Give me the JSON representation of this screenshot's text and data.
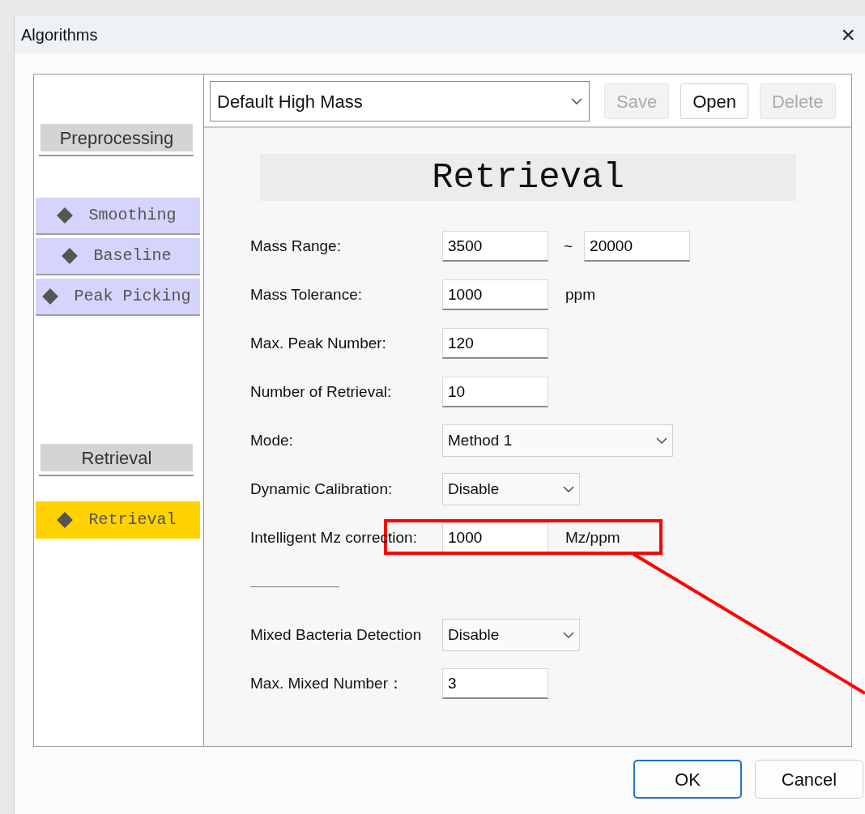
{
  "window": {
    "title": "Algorithms",
    "close": "×"
  },
  "sidebar": {
    "sections": [
      {
        "title": "Preprocessing",
        "items": [
          {
            "label": "Smoothing",
            "selected": false
          },
          {
            "label": "Baseline",
            "selected": false
          },
          {
            "label": "Peak Picking",
            "selected": false
          }
        ]
      },
      {
        "title": "Retrieval",
        "items": [
          {
            "label": "Retrieval",
            "selected": true
          }
        ]
      }
    ]
  },
  "toolbar": {
    "preset": "Default High Mass",
    "buttons": [
      {
        "label": "Save",
        "disabled": true
      },
      {
        "label": "Open",
        "disabled": false
      },
      {
        "label": "Delete",
        "disabled": true
      }
    ]
  },
  "heading": "Retrieval",
  "form": {
    "rows": [
      {
        "kind": "range",
        "label": "Mass Range:",
        "value": "3500",
        "separator": "~",
        "value2": "20000"
      },
      {
        "kind": "input",
        "label": "Mass Tolerance:",
        "value": "1000",
        "unit": "ppm"
      },
      {
        "kind": "input",
        "label": "Max. Peak Number:",
        "value": "120"
      },
      {
        "kind": "input",
        "label": "Number of Retrieval:",
        "value": "10"
      },
      {
        "kind": "combo",
        "label": "Mode:",
        "value": "Method 1"
      },
      {
        "kind": "select",
        "label": "Dynamic Calibration:",
        "value": "Disable"
      },
      {
        "kind": "input",
        "label": "Intelligent Mz correction:",
        "value": "1000",
        "unit": "Mz/ppm"
      },
      {
        "kind": "divider"
      },
      {
        "kind": "select",
        "label": "Mixed Bacteria Detection",
        "value": "Disable"
      },
      {
        "kind": "input",
        "label": "Max. Mixed Number：",
        "value": "3"
      }
    ]
  },
  "footer": {
    "buttons": [
      {
        "label": "OK",
        "default": true
      },
      {
        "label": "Cancel",
        "default": false
      }
    ]
  },
  "highlight_annotation": {
    "visible": true
  }
}
